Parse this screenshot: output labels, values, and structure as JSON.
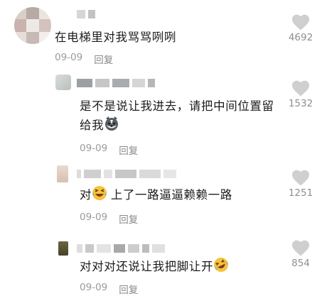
{
  "comments": [
    {
      "text": "在电梯里对我骂骂咧咧",
      "date": "09-09",
      "reply": "回复",
      "likes": "4692"
    },
    {
      "text": "是不是说让我进去，请把中间位置留给我",
      "date": "09-09",
      "reply": "回复",
      "likes": "1532",
      "emoji": "husky-face"
    },
    {
      "text": "对",
      "text2": "上了一路逼逼赖赖一路",
      "date": "09-09",
      "reply": "回复",
      "likes": "1251",
      "emoji": "laughing-face"
    },
    {
      "text": "对对对还说让我把脚让开",
      "date": "09-09",
      "reply": "回复",
      "likes": "854",
      "emoji": "rofl-face"
    }
  ]
}
